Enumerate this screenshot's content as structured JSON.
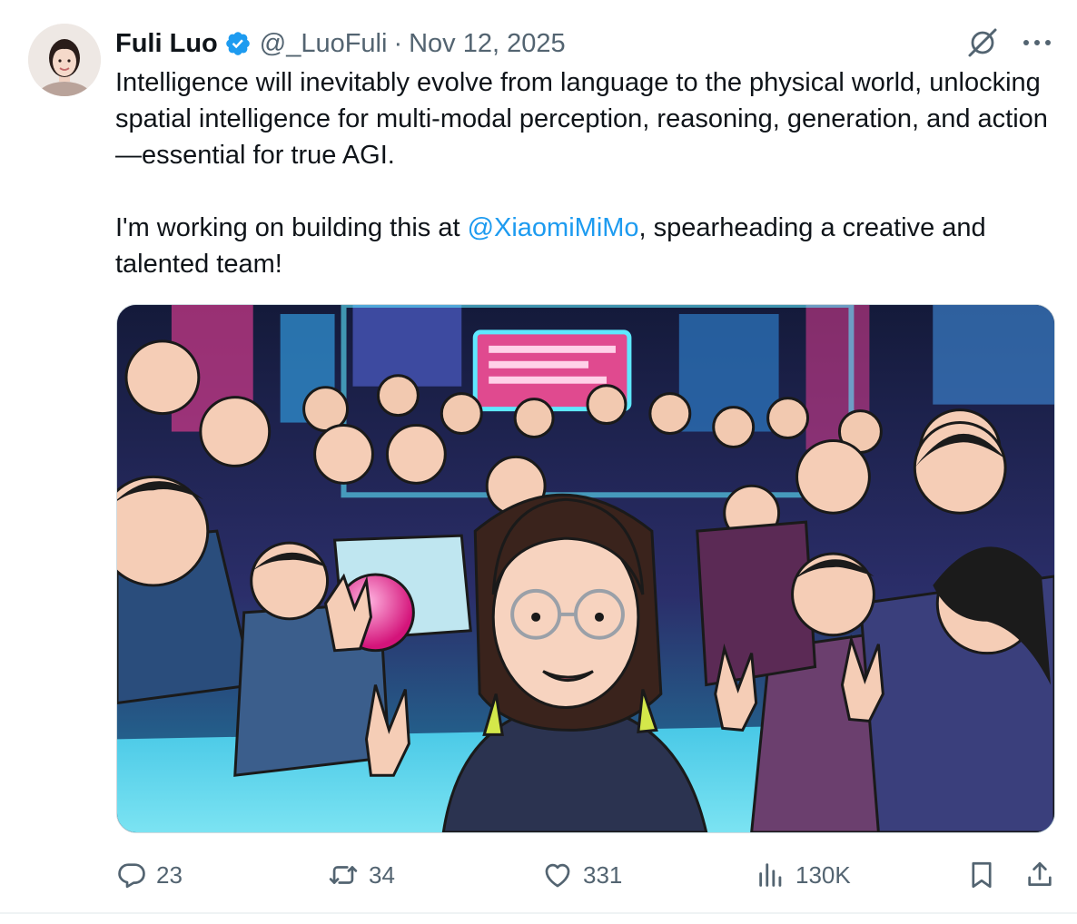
{
  "author": {
    "display_name": "Fuli Luo",
    "handle": "@_LuoFuli",
    "separator": "·",
    "date": "Nov 12, 2025",
    "verified": true
  },
  "icons": {
    "avatar": "avatar",
    "verified": "verified-badge-icon",
    "grok": "grok-icon",
    "more": "more-icon",
    "reply": "reply-icon",
    "repost": "repost-icon",
    "like": "heart-icon",
    "views": "views-icon",
    "bookmark": "bookmark-icon",
    "share": "share-icon"
  },
  "tweet": {
    "paragraph1": "Intelligence will inevitably evolve from language to the physical world, unlocking spatial intelligence for multi-modal perception, reasoning, generation, and action—essential for true AGI.",
    "paragraph2_before": "I'm working on building this at ",
    "mention": "@XiaomiMiMo",
    "paragraph2_after": ", spearheading a creative and talented team!"
  },
  "media": {
    "kind": "illustration",
    "style": "comic-style group selfie in a neon cyberpunk lab"
  },
  "metrics": {
    "replies": "23",
    "reposts": "34",
    "likes": "331",
    "views": "130K"
  },
  "colors": {
    "text": "#0f1419",
    "secondary": "#536471",
    "accent": "#1d9bf0",
    "border": "#cfd9de"
  }
}
